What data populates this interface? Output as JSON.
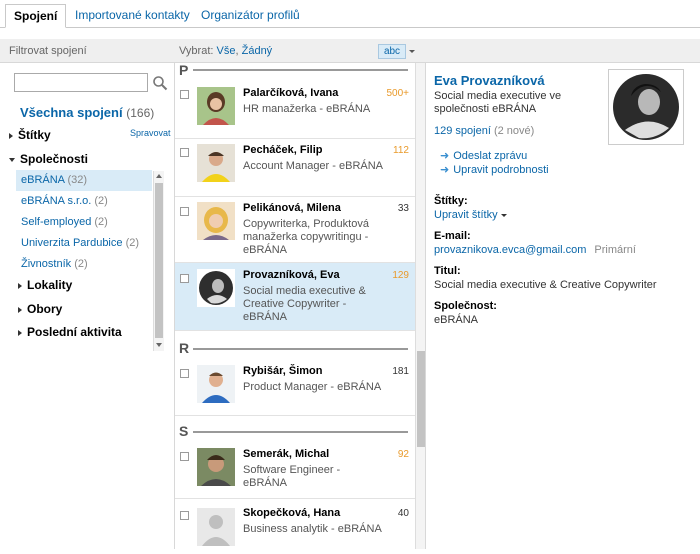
{
  "tabs": [
    {
      "label": "Spojení"
    },
    {
      "label": "Importované kontakty"
    },
    {
      "label": "Organizátor profilů"
    }
  ],
  "filter_label": "Filtrovat spojení",
  "select": {
    "label": "Vybrat:",
    "all": "Vše",
    "none": "Žádný",
    "sort_button": "abc"
  },
  "left": {
    "search": {
      "value": "",
      "placeholder": ""
    },
    "all_connections": {
      "label": "Všechna spojení",
      "count": "(166)"
    },
    "tags": {
      "label": "Štítky",
      "manage": "Spravovat"
    },
    "companies": {
      "label": "Společnosti",
      "items": [
        {
          "name": "eBRÁNA",
          "count": "(32)"
        },
        {
          "name": "eBRÁNA s.r.o.",
          "count": "(2)"
        },
        {
          "name": "Self-employed",
          "count": "(2)"
        },
        {
          "name": "Univerzita Pardubice",
          "count": "(2)"
        },
        {
          "name": "Živnostník",
          "count": "(2)"
        }
      ]
    },
    "locations": {
      "label": "Lokality"
    },
    "industries": {
      "label": "Obory"
    },
    "recent": {
      "label": "Poslední aktivita"
    }
  },
  "letters": {
    "p": "P",
    "r": "R",
    "s": "S"
  },
  "contacts": [
    {
      "name": "Palarčíková, Ivana",
      "title": "HR manažerka - eBRÁNA",
      "count": "500+"
    },
    {
      "name": "Pecháček, Filip",
      "title": "Account Manager - eBRÁNA",
      "count": "112"
    },
    {
      "name": "Pelikánová, Milena",
      "title": "Copywriterka, Produktová manažerka copywritingu - eBRÁNA",
      "count": "33"
    },
    {
      "name": "Provazníková, Eva",
      "title": "Social media executive & Creative Copywriter - eBRÁNA",
      "count": "129"
    },
    {
      "name": "Rybišár, Šimon",
      "title": "Product Manager - eBRÁNA",
      "count": "181"
    },
    {
      "name": "Semerák, Michal",
      "title": "Software Engineer - eBRÁNA",
      "count": "92"
    },
    {
      "name": "Skopečková, Hana",
      "title": "Business analytik - eBRÁNA",
      "count": "40"
    }
  ],
  "profile": {
    "name": "Eva Provazníková",
    "headline": "Social media executive ve společnosti eBRÁNA",
    "connections": "129 spojení",
    "connections_new": "(2 nové)",
    "send_message": "Odeslat zprávu",
    "edit_details": "Upravit podrobnosti",
    "tags_label": "Štítky:",
    "tags_edit": "Upravit štítky",
    "email_label": "E-mail:",
    "email": "provaznikova.evca@gmail.com",
    "email_primary": "Primární",
    "title_label": "Titul:",
    "title": "Social media executive & Creative Copywriter",
    "company_label": "Společnost:",
    "company": "eBRÁNA"
  },
  "colors": {
    "link": "#0a66a8",
    "selected": "#d9ebf7",
    "count_orange": "#e99a2b"
  }
}
